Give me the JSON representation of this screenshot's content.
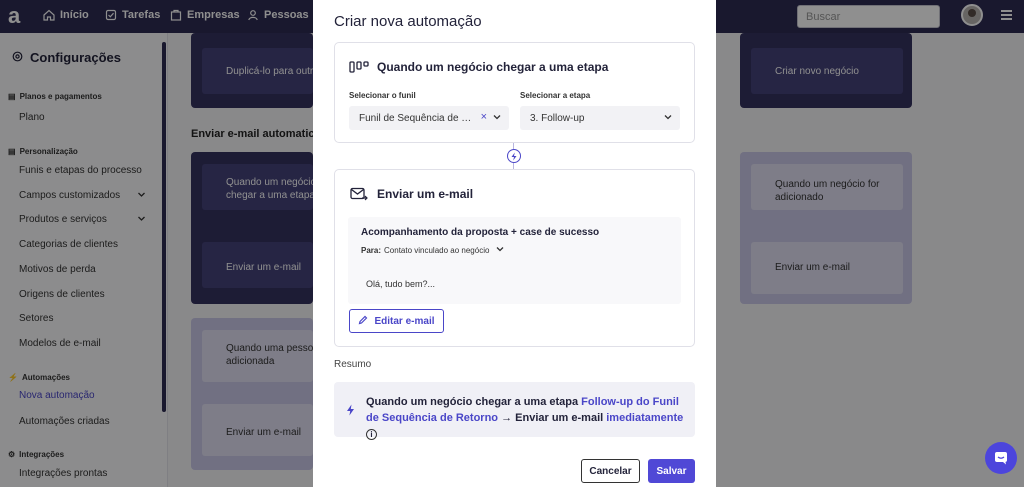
{
  "topbar": {
    "nav": [
      {
        "label": "Início",
        "icon": "home-icon"
      },
      {
        "label": "Tarefas",
        "icon": "tasks-icon"
      },
      {
        "label": "Empresas",
        "icon": "building-icon"
      },
      {
        "label": "Pessoas",
        "icon": "people-icon"
      }
    ],
    "search_placeholder": "Buscar"
  },
  "sidebar": {
    "title": "Configurações",
    "sections": [
      {
        "title": "Planos e pagamentos",
        "items": [
          "Plano"
        ]
      },
      {
        "title": "Personalização",
        "items": [
          "Funis e etapas do processo",
          "Campos customizados",
          "Produtos e serviços",
          "Categorias de clientes",
          "Motivos de perda",
          "Origens de clientes",
          "Setores",
          "Modelos de e-mail"
        ]
      },
      {
        "title": "Automações",
        "items": [
          "Nova automação",
          "Automações criadas"
        ]
      },
      {
        "title": "Integrações",
        "items": [
          "Integrações prontas"
        ]
      }
    ]
  },
  "background": {
    "heading": "Enviar e-mail automatica",
    "cards": {
      "duplicate": "Duplicá-lo para outr",
      "create_deal": "Criar novo negócio",
      "deal_stage_1": "Quando um negócio",
      "deal_stage_2": "chegar a uma etapa",
      "send_email_1": "Enviar um e-mail",
      "deal_added_1": "Quando um negócio for",
      "deal_added_2": "adicionado",
      "send_email_2": "Enviar um e-mail",
      "person_added_1": "Quando uma pesso",
      "person_added_2": "adicionada",
      "send_email_3": "Enviar um e-mail"
    }
  },
  "modal": {
    "title": "Criar nova automação",
    "trigger": {
      "heading": "Quando um negócio chegar a uma etapa",
      "funnel_label": "Selecionar o funil",
      "funnel_value": "Funil de Sequência de Retorno",
      "stage_label": "Selecionar a etapa",
      "stage_value": "3. Follow-up"
    },
    "action": {
      "heading": "Enviar um e-mail",
      "subject": "Acompanhamento da proposta + case de sucesso",
      "to_label": "Para:",
      "to_value": "Contato vinculado ao negócio",
      "body": "Olá, tudo bem?...",
      "edit_button": "Editar e-mail"
    },
    "summary": {
      "label": "Resumo",
      "part1": "Quando um negócio chegar a uma etapa ",
      "highlight1": "Follow-up do Funil de Sequência de Retorno",
      "part2": " → Enviar um e-mail ",
      "highlight2": "imediatamente"
    },
    "cancel_button": "Cancelar",
    "save_button": "Salvar"
  },
  "colors": {
    "accent": "#4a46c8",
    "topbar": "#2d2b52",
    "overlay": "rgba(0,0,0,0.44)"
  }
}
